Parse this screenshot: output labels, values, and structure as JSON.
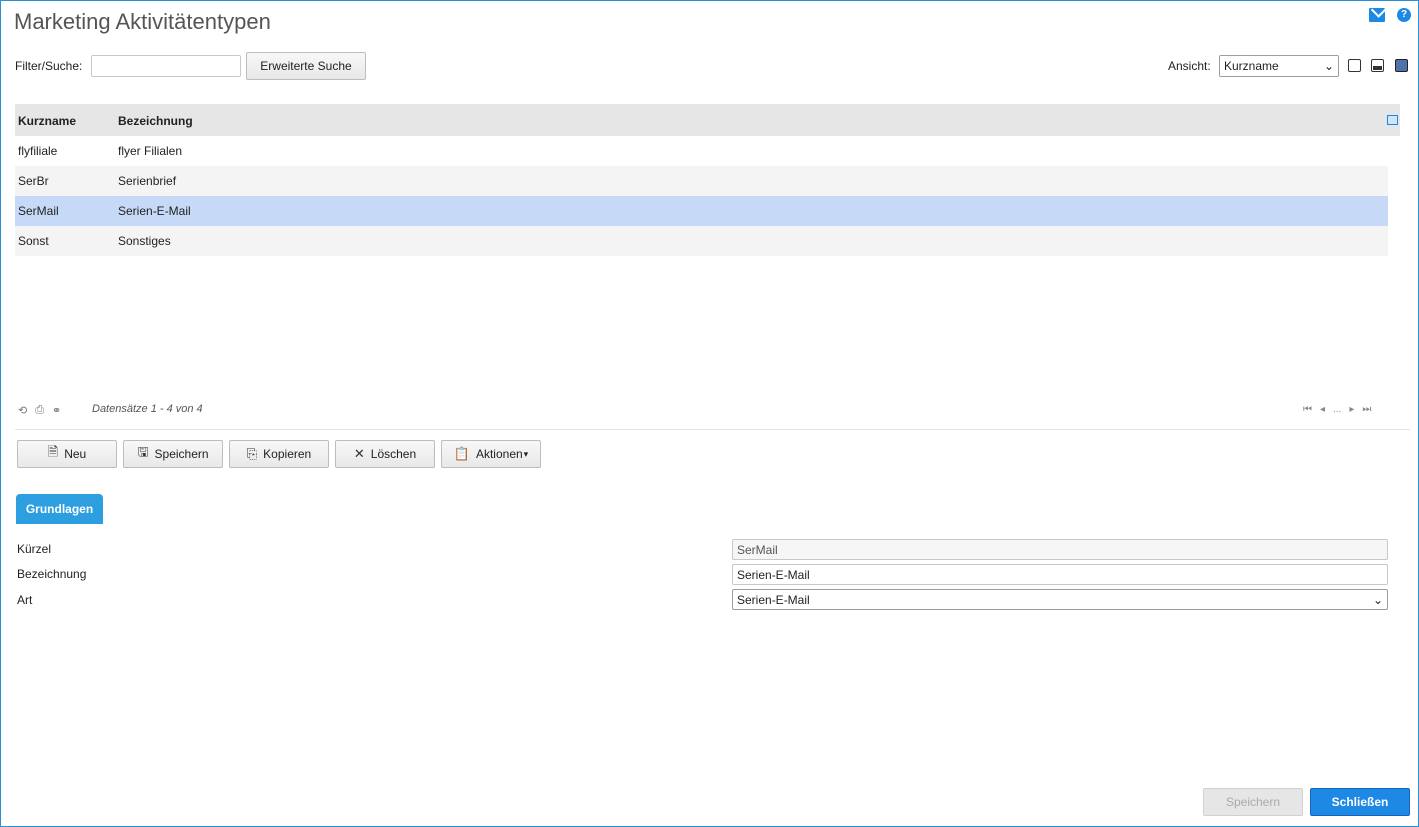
{
  "window": {
    "title": "Marketing Aktivitätentypen"
  },
  "icons": {
    "mail": "mail-icon",
    "help": "help-icon"
  },
  "filter": {
    "label": "Filter/Suche:",
    "value": "",
    "advanced_search": "Erweiterte Suche"
  },
  "view": {
    "label": "Ansicht:",
    "selected": "Kurzname"
  },
  "table": {
    "headers": [
      "Kurzname",
      "Bezeichnung"
    ],
    "rows": [
      {
        "kurzname": "flyfiliale",
        "bezeichnung": "flyer Filialen"
      },
      {
        "kurzname": "SerBr",
        "bezeichnung": "Serienbrief"
      },
      {
        "kurzname": "SerMail",
        "bezeichnung": "Serien-E-Mail"
      },
      {
        "kurzname": "Sonst",
        "bezeichnung": "Sonstiges"
      }
    ],
    "record_count": "Datensätze 1 - 4 von 4",
    "pager_ellipsis": "..."
  },
  "toolbar": {
    "new": "Neu",
    "save": "Speichern",
    "copy": "Kopieren",
    "delete": "Löschen",
    "actions": "Aktionen"
  },
  "tabs": {
    "basics": "Grundlagen"
  },
  "form": {
    "kuerzel_label": "Kürzel",
    "kuerzel_value": "SerMail",
    "bezeichnung_label": "Bezeichnung",
    "bezeichnung_value": "Serien-E-Mail",
    "art_label": "Art",
    "art_value": "Serien-E-Mail"
  },
  "footer": {
    "save": "Speichern",
    "close": "Schließen"
  },
  "colors": {
    "accent": "#1e88e5",
    "selected_row": "#c6d9f6",
    "tab": "#2d9ee0"
  }
}
